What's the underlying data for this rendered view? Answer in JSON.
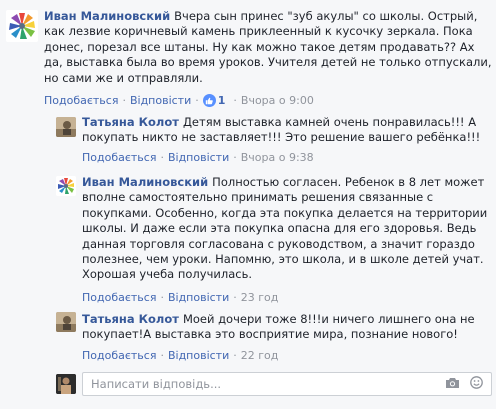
{
  "reply_actions": {
    "like": "Подобається",
    "reply": "Відповісти"
  },
  "comments": [
    {
      "author": "Иван Малиновский",
      "text": "Вчера сын принес \"зуб акулы\" со школы. Острый, как лезвие коричневый камень приклеенный к кусочку зеркала. Пока донес, порезал все штаны. Ну как можно такое детям продавать?? Ах да, выставка была во время уроков. Учителя детей не только отпускали, но сами же и отправляли.",
      "likes": "1",
      "time": "Вчора о 9:00"
    },
    {
      "author": "Татьяна Колот",
      "text": "Детям выставка камней очень понравилась!!! А покупать никто не заставляет!!! Это решение вашего ребёнка!!!",
      "time": "Вчора о 9:38"
    },
    {
      "author": "Иван Малиновский",
      "text": "Полностью согласен. Ребенок в 8 лет может вполне самостоятельно принимать решения связанные с покупками. Особенно, когда эта покупка делается на территории школы. И даже если эта покупка опасна для его здоровья. Ведь данная торговля согласована с руководством, а значит гораздо полезнее, чем уроки. Напомню, это школа, и в школе детей учат. Хорошая учеба получилась.",
      "time": "23 год"
    },
    {
      "author": "Татьяна Колот",
      "text": "Моей дочери тоже 8!!!и ничего лишнего она не покупает!А выставка это восприятие мира, познание нового!",
      "time": "22 год"
    }
  ],
  "reply_box": {
    "placeholder": "Написати відповідь..."
  },
  "icons": [
    "mosaic-avatar",
    "person-avatar",
    "like-icon",
    "camera-icon",
    "emoji-icon"
  ],
  "colors": {
    "name": "#365899",
    "link": "#4267b2",
    "meta": "#90949c",
    "like": "#5890ff"
  }
}
